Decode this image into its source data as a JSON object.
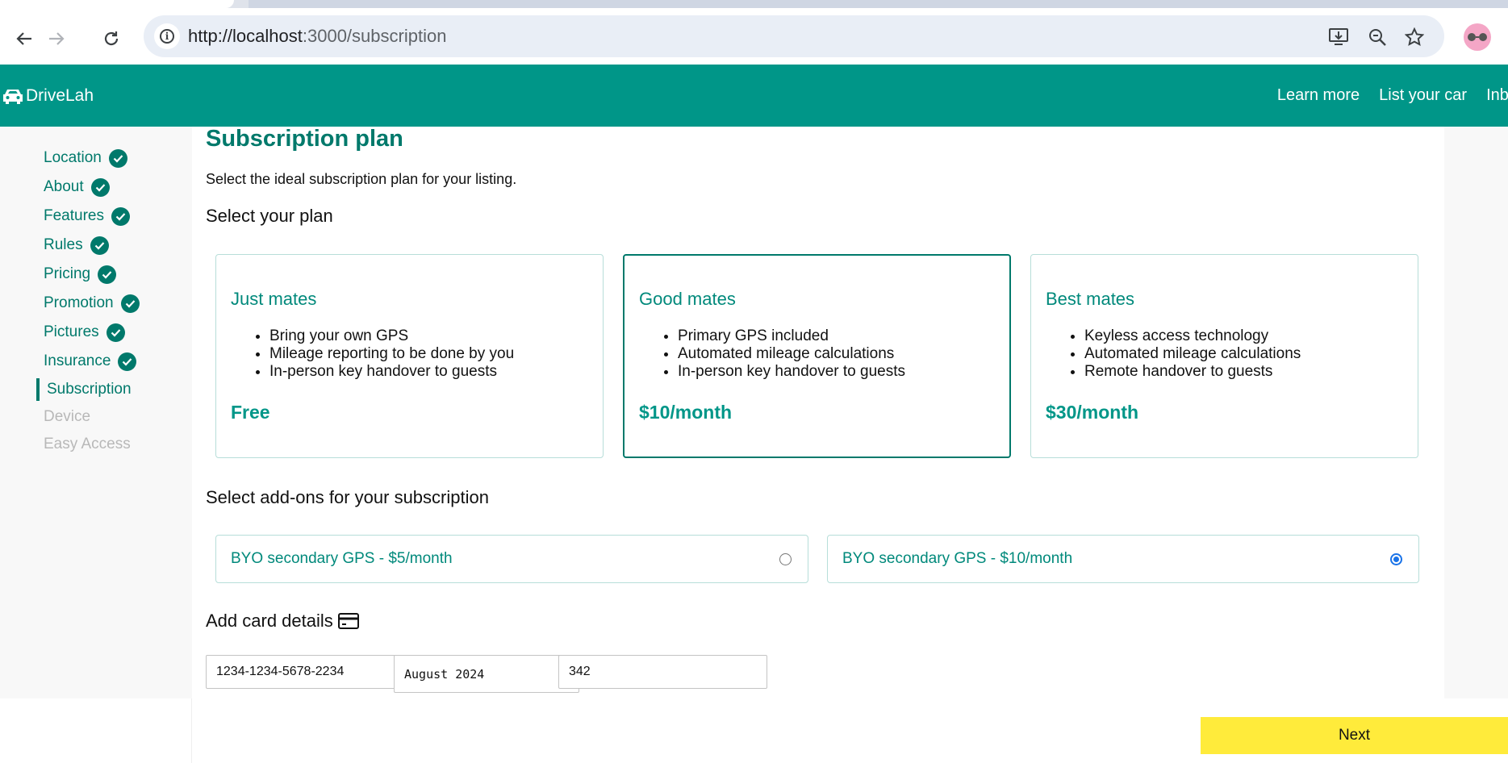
{
  "browser": {
    "url_host": "http://localhost",
    "url_rest": ":3000/subscription"
  },
  "header": {
    "brand": "DriveLah",
    "nav": [
      "Learn more",
      "List your car",
      "Inbox"
    ]
  },
  "sidebar": {
    "steps": [
      {
        "label": "Location",
        "state": "done"
      },
      {
        "label": "About",
        "state": "done"
      },
      {
        "label": "Features",
        "state": "done"
      },
      {
        "label": "Rules",
        "state": "done"
      },
      {
        "label": "Pricing",
        "state": "done"
      },
      {
        "label": "Promotion",
        "state": "done"
      },
      {
        "label": "Pictures",
        "state": "done"
      },
      {
        "label": "Insurance",
        "state": "done"
      },
      {
        "label": "Subscription",
        "state": "current"
      },
      {
        "label": "Device",
        "state": "disabled"
      },
      {
        "label": "Easy Access",
        "state": "disabled"
      }
    ]
  },
  "main": {
    "title": "Subscription plan",
    "subtitle": "Select the ideal subscription plan for your listing.",
    "plan_section": "Select your plan",
    "plans": [
      {
        "name": "Just mates",
        "features": [
          "Bring your own GPS",
          "Mileage reporting to be done by you",
          "In-person key handover to guests"
        ],
        "price": "Free",
        "selected": false
      },
      {
        "name": "Good mates",
        "features": [
          "Primary GPS included",
          "Automated mileage calculations",
          "In-person key handover to guests"
        ],
        "price": "$10/month",
        "selected": true
      },
      {
        "name": "Best mates",
        "features": [
          "Keyless access technology",
          "Automated mileage calculations",
          "Remote handover to guests"
        ],
        "price": "$30/month",
        "selected": false
      }
    ],
    "addon_section": "Select add-ons for your subscription",
    "addons": [
      {
        "label": "BYO secondary GPS - $5/month",
        "checked": false
      },
      {
        "label": "BYO secondary GPS - $10/month",
        "checked": true
      }
    ],
    "card_section": "Add card details",
    "card": {
      "number": "1234-1234-5678-2234",
      "expiry": "August 2024",
      "cvc": "342"
    },
    "next_label": "Next"
  },
  "colors": {
    "brand": "#009688",
    "accent_text": "#00796b",
    "next_button": "#ffeb3b"
  }
}
